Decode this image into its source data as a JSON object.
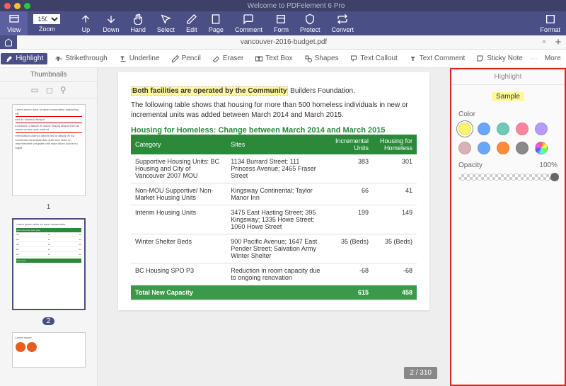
{
  "app_title": "Welcome to PDFelement 6 Pro",
  "ribbon": {
    "view": "View",
    "zoom": "Zoom",
    "zoom_value": "150%",
    "up": "Up",
    "down": "Down",
    "hand": "Hand",
    "select": "Select",
    "edit": "Edit",
    "page": "Page",
    "comment": "Comment",
    "form": "Form",
    "protect": "Protect",
    "convert": "Convert",
    "format": "Format"
  },
  "tab": {
    "filename": "vancouver-2016-budget.pdf"
  },
  "tools": {
    "highlight": "Highlight",
    "strike": "Strikethrough",
    "underline": "Underline",
    "pencil": "Pencil",
    "eraser": "Eraser",
    "textbox": "Text Box",
    "shapes": "Shapes",
    "callout": "Text Callout",
    "textcomment": "Text Comment",
    "sticky": "Sticky Note",
    "more": "More"
  },
  "thumbnails": {
    "title": "Thumbnails",
    "page1": "1",
    "page2": "2"
  },
  "doc": {
    "hl": "Both facilities are operated by the Community",
    "hl_tail": " Builders Foundation.",
    "para": "The following table shows that housing for more than 500 homeless individuals in new or incremental units was added between March 2014 and March 2015.",
    "table_title": "Housing for Homeless: Change between March 2014 and March 2015",
    "headers": {
      "cat": "Category",
      "sites": "Sites",
      "inc": "Incremental Units",
      "hh": "Housing for Homeless"
    },
    "rows": [
      {
        "cat": "Supportive Housing Units: BC Housing and City of Vancouver 2007 MOU",
        "sites": "1134 Burrard Street; 111 Princess Avenue; 2465 Fraser Street",
        "inc": "383",
        "hh": "301"
      },
      {
        "cat": "Non-MOU Supportive/ Non-Market Housing Units",
        "sites": "Kingsway Continental; Taylor Manor Inn",
        "inc": "66",
        "hh": "41"
      },
      {
        "cat": "Interim Housing Units",
        "sites": "3475 East Hasting Street; 395 Kingsway; 1335 Howe Street; 1060 Howe Street",
        "inc": "199",
        "hh": "149"
      },
      {
        "cat": "Winter Shelter Beds",
        "sites": "900 Pacific Avenue; 1647 East Pender Street; Salvation Army Winter Shelter",
        "inc": "35 (Beds)",
        "hh": "35 (Beds)"
      },
      {
        "cat": "BC Housing SPO P3",
        "sites": "Reduction in room capacity due to ongoing renovation",
        "inc": "-68",
        "hh": "-68"
      }
    ],
    "total": {
      "label": "Total New Capacity",
      "inc": "615",
      "hh": "458"
    },
    "page_indicator": "2 / 310"
  },
  "props": {
    "title": "Highlight",
    "sample": "Sample",
    "color_label": "Color",
    "colors": [
      "#fff36b",
      "#6aa6ff",
      "#6fc9b9",
      "#ff85a1",
      "#b49cff",
      "#d9b3b3",
      "#6aa6ff",
      "#ff8c3a",
      "#8a8a8a"
    ],
    "multicolor": true,
    "opacity_label": "Opacity",
    "opacity_value": "100%"
  }
}
